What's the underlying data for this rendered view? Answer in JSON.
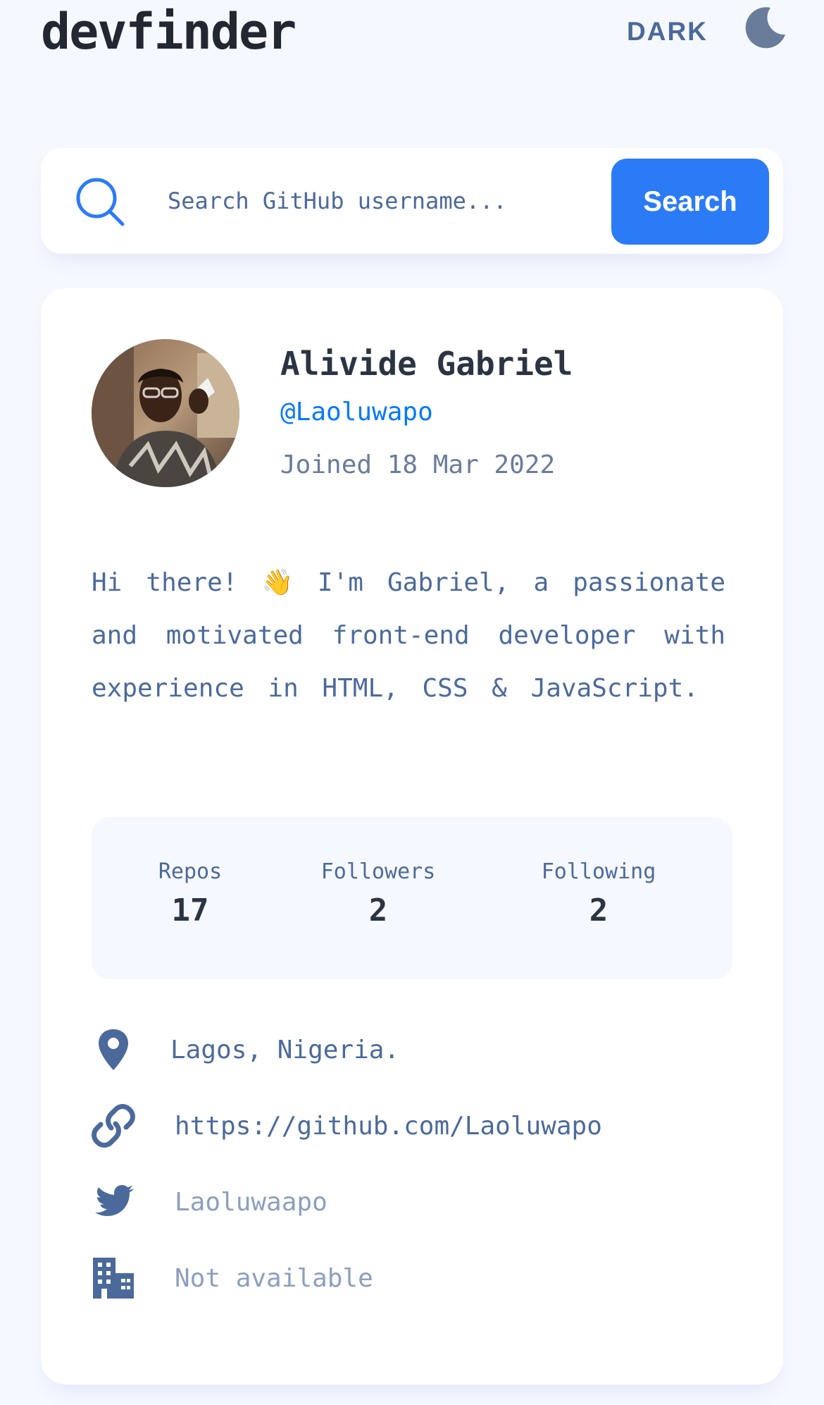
{
  "header": {
    "logo": "devfinder",
    "theme_toggle_label": "DARK",
    "theme_icon": "moon-icon"
  },
  "search": {
    "icon": "search-icon",
    "placeholder": "Search GitHub username...",
    "value": "",
    "button_label": "Search"
  },
  "profile": {
    "avatar_icon": "avatar-photo",
    "name": "Alivide Gabriel",
    "login": "@Laoluwapo",
    "joined": "Joined 18 Mar 2022",
    "bio": "Hi there! 👋 I'm Gabriel, a passionate and motivated front-end developer with experience in HTML, CSS & JavaScript."
  },
  "stats": {
    "repos_label": "Repos",
    "repos_value": "17",
    "followers_label": "Followers",
    "followers_value": "2",
    "following_label": "Following",
    "following_value": "2"
  },
  "links": {
    "location": {
      "icon": "location-pin-icon",
      "text": "Lagos, Nigeria."
    },
    "blog": {
      "icon": "link-icon",
      "text": "https://github.com/Laoluwapo"
    },
    "twitter": {
      "icon": "twitter-icon",
      "text": "Laoluwaapo"
    },
    "company": {
      "icon": "building-icon",
      "text": "Not available"
    }
  },
  "colors": {
    "background": "#f6f8ff",
    "card": "#ffffff",
    "accent": "#2b7bf7",
    "link_blue": "#0079ff",
    "text_primary": "#2b3442",
    "text_secondary": "#4b6a9b",
    "text_muted": "#8c9fbd"
  }
}
